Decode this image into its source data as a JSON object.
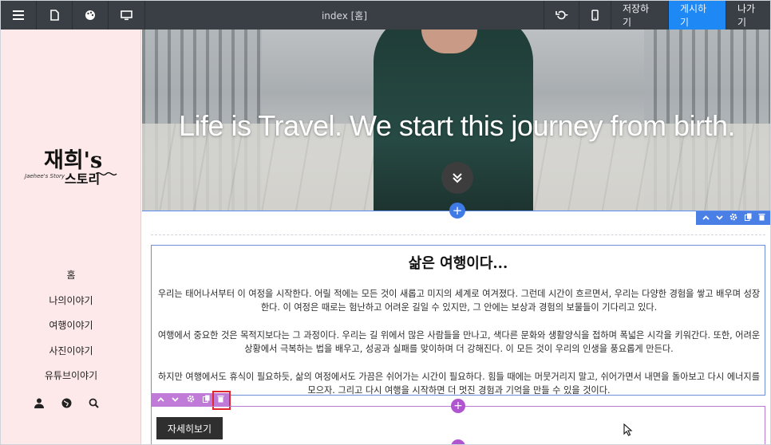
{
  "toolbar": {
    "title": "index [홈]",
    "save_label": "저장하기",
    "publish_label": "게시하기",
    "exit_label": "나가기",
    "icons": [
      "menu-icon",
      "file-icon",
      "palette-icon",
      "desktop-icon",
      "undo-icon",
      "mobile-icon"
    ]
  },
  "sidebar": {
    "logo_main": "재희's",
    "logo_sub": "스토리",
    "logo_script": "Jaehee's Story",
    "items": [
      {
        "label": "홈"
      },
      {
        "label": "나의이야기"
      },
      {
        "label": "여행이야기"
      },
      {
        "label": "사진이야기"
      },
      {
        "label": "유튜브이야기"
      }
    ],
    "icons": [
      "user-icon",
      "globe-icon",
      "search-icon"
    ]
  },
  "hero": {
    "title": "Life is Travel. We start this journey from birth."
  },
  "content": {
    "heading": "삶은 여행이다...",
    "paragraphs": [
      "우리는 태어나서부터 이 여정을 시작한다. 어릴 적에는 모든 것이 새롭고 미지의 세계로 여겨졌다. 그런데 시간이 흐르면서, 우리는 다양한 경험을 쌓고 배우며 성장한다. 이 여정은 때로는 험난하고 어려운 길일 수 있지만, 그 안에는 보상과 경험의 보물들이 기다리고 있다.",
      "여행에서 중요한 것은 목적지보다는 그 과정이다. 우리는 길 위에서 많은 사람들을 만나고, 색다른 문화와 생활양식을 접하며 폭넓은 시각을 키워간다. 또한, 어려운 상황에서 극복하는 법을 배우고, 성공과 실패를 맞이하며 더 강해진다. 이 모든 것이 우리의 인생을 풍요롭게 만든다.",
      "하지만 여행에서도 휴식이 필요하듯, 삶의 여정에서도 가끔은 쉬어가는 시간이 필요하다. 힘들 때에는 머뭇거리지 말고, 쉬어가면서 내면을 돌아보고 다시 에너지를 모으자. 그리고 다시 여행을 시작하면 더 멋진 경험과 기억을 만들 수 있을 것이다."
    ],
    "more_button": "자세히보기"
  },
  "colors": {
    "toolbar_bg": "#3a3f46",
    "publish_bg": "#1e88f5",
    "sidebar_bg": "#fde9e9",
    "section_tools": "#4a7fe6",
    "block_tools": "#c07ad8",
    "highlight": "#e0262e"
  }
}
